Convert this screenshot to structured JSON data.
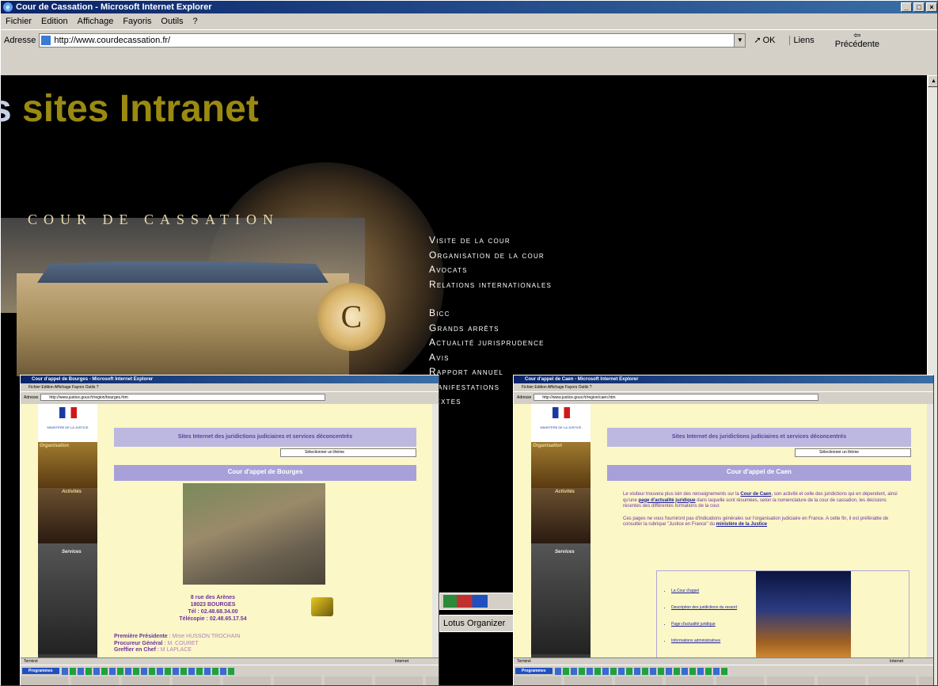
{
  "browser": {
    "title": "Cour de Cassation - Microsoft Internet Explorer",
    "menu": [
      "Fichier",
      "Edition",
      "Affichage",
      "Fayoris",
      "Outils",
      "?"
    ],
    "address_label": "Adresse",
    "url": "http://www.courdecassation.fr/",
    "ok_label": "OK",
    "links_label": "Liens",
    "back_label": "Précédente"
  },
  "slide": {
    "title": "sites Intranet",
    "title_prefix": "s"
  },
  "site": {
    "logo_text": "COUR DE CASSATION",
    "nav_group1": [
      "Visite de la cour",
      "Organisation de la cour",
      "Avocats",
      "Relations internationales"
    ],
    "nav_group2": [
      "Bicc",
      "Grands arrêts",
      "Actualité jurisprudence",
      "Avis",
      "Rapport annuel",
      "Manifestations",
      "Textes"
    ]
  },
  "bourges": {
    "title": "Cour d'appel de Bourges - Microsoft Internet Explorer",
    "menu": "Fichier  Edition  Affichage  Fayors  Outils  ?",
    "url": "http://www.justice.gouv.fr/region/bourges.htm",
    "banner": "Sites Internet des juridictions judiciaires et services déconcentrés",
    "select": "Sélectionner un thème",
    "court": "Cour d'appel de Bourges",
    "address": [
      "8 rue des Arènes",
      "18023 BOURGES",
      "Tél : 02.48.68.34.00",
      "Télécopie : 02.48.65.17.54"
    ],
    "staff": [
      {
        "role": "Première Présidente",
        "name": "Mme HUSSON TROCHAIN"
      },
      {
        "role": "Procureur Général",
        "name": "M. COURET"
      },
      {
        "role": "Greffier en Chef",
        "name": "M LAPLACE"
      }
    ],
    "ministry": "MINISTÈRE DE LA JUSTICE",
    "side_labels": [
      "Organisation",
      "Activités",
      "Services"
    ],
    "status": "Terminé",
    "zone": "Internet",
    "start": "Programmes"
  },
  "caen": {
    "title": "Cour d'appel de Caen - Microsoft Internet Explorer",
    "menu": "Fichier  Edition  Affichage  Fayors  Outils  ?",
    "url": "http://www.justice.gouv.fr/region/caen.htm",
    "banner": "Sites Internet des juridictions judiciaires et services déconcentrés",
    "select": "Sélectionner un thème",
    "court": "Cour d'appel de Caen",
    "p1_a": "Le visiteur trouvera plus loin des renseignements sur la ",
    "p1_link1": "Cour de Caen",
    "p1_b": ", son activité et celle des juridictions qui en dépendent, ainsi qu'une ",
    "p1_link2": "page d'actualité juridique",
    "p1_c": " dans laquelle sont résumées, selon la nomenclature de la cour de cassation, les décisions récentes des différentes formations de la cour.",
    "p2_a": "Ces pages ne vous fourniront pas d'indications générales sur l'organisation judiciaire en France. A cette fin, il est préférable de consulter la rubrique \"Justice en France\" du ",
    "p2_link": "ministère de la Justice",
    "links": [
      "La Cour d'appel",
      "Description des juridictions du ressort",
      "Page d'actualité juridique",
      "Informations administratives"
    ],
    "status": "Terminé",
    "zone": "Internet",
    "start": "Programmes"
  },
  "background_taskbar": {
    "lotus": "Lotus Organizer"
  }
}
